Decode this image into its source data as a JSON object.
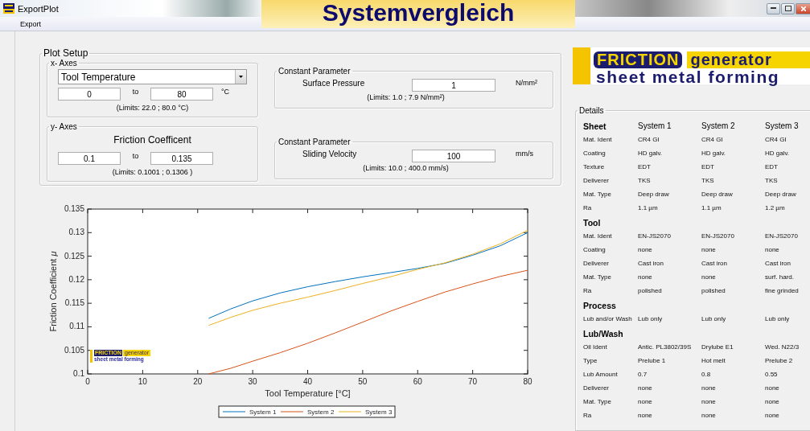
{
  "overlay_title": "Systemvergleich",
  "window": {
    "title": "ExportPlot"
  },
  "menu": [
    "Export"
  ],
  "plot_setup": {
    "title": "Plot Setup",
    "x_axes": {
      "title": "x- Axes",
      "dropdown": "Tool Temperature",
      "from": "0",
      "to_label": "to",
      "to": "80",
      "unit": "°C",
      "limits": "(Limits: 22.0 ; 80.0 °C)"
    },
    "y_axes": {
      "title": "y- Axes",
      "quantity": "Friction Coefficent",
      "from": "0.1",
      "to_label": "to",
      "to": "0.135",
      "limits": "(Limits: 0.1001 ; 0.1306 )"
    },
    "constant_parameters": [
      {
        "title": "Constant Parameter",
        "label": "Surface Pressure",
        "value": "1",
        "unit": "N/mm²",
        "limits": "(Limits: 1.0 ; 7.9 N/mm²)"
      },
      {
        "title": "Constant Parameter",
        "label": "Sliding Velocity",
        "value": "100",
        "unit": "mm/s",
        "limits": "(Limits: 10.0 ; 400.0 mm/s)"
      }
    ]
  },
  "plot": {
    "logo": {
      "word_1": "FRICTION",
      "word_2": "generator",
      "line_2": "sheet metal forming"
    },
    "chart_data": {
      "type": "line",
      "legend": "bottom",
      "xlabel": "Tool Temperature [°C]",
      "ylabel": "Friction Coefficient *μ*",
      "x": [
        22,
        26,
        30,
        35,
        40,
        45,
        50,
        55,
        60,
        65,
        70,
        75,
        80
      ],
      "xlim": [
        0,
        80
      ],
      "ylim": [
        0.1,
        0.135
      ],
      "xticks": [
        0,
        10,
        20,
        30,
        40,
        50,
        60,
        70,
        80
      ],
      "yticks": [
        0.1,
        0.105,
        0.11,
        0.115,
        0.12,
        0.125,
        0.13,
        0.135
      ],
      "series": [
        {
          "name": "System 1",
          "color": "#0072bd",
          "values": [
            0.1118,
            0.1138,
            0.1155,
            0.1172,
            0.1185,
            0.1196,
            0.1206,
            0.1215,
            0.1224,
            0.1235,
            0.1252,
            0.1272,
            0.13
          ]
        },
        {
          "name": "System 2",
          "color": "#d95319",
          "values": [
            0.1,
            0.1012,
            0.1027,
            0.1045,
            0.1065,
            0.1087,
            0.111,
            0.1133,
            0.1154,
            0.1174,
            0.1191,
            0.1207,
            0.122
          ]
        },
        {
          "name": "System 3",
          "color": "#edb120",
          "values": [
            0.1103,
            0.112,
            0.1135,
            0.115,
            0.1163,
            0.1177,
            0.1192,
            0.1206,
            0.1222,
            0.1236,
            0.1254,
            0.1276,
            0.1305
          ]
        }
      ]
    }
  },
  "logo": {
    "word_1": "FRICTION",
    "word_2": "generator",
    "line_2": "sheet metal forming"
  },
  "details": {
    "title": "Details",
    "columns": [
      "System 1",
      "System 2",
      "System 3"
    ],
    "sections": [
      {
        "title": "Sheet",
        "rows": [
          {
            "label": "Mat. Ident",
            "values": [
              "CR4 GI",
              "CR4 GI",
              "CR4 GI"
            ]
          },
          {
            "label": "Coating",
            "values": [
              "HD galv.",
              "HD galv.",
              "HD galv."
            ]
          },
          {
            "label": "Texture",
            "values": [
              "EDT",
              "EDT",
              "EDT"
            ]
          },
          {
            "label": "Deliverer",
            "values": [
              "TKS",
              "TKS",
              "TKS"
            ]
          },
          {
            "label": "Mat. Type",
            "values": [
              "Deep draw",
              "Deep draw",
              "Deep draw"
            ]
          },
          {
            "label": "Ra",
            "values": [
              "1.1 µm",
              "1.1 µm",
              "1.2 µm"
            ]
          }
        ]
      },
      {
        "title": "Tool",
        "rows": [
          {
            "label": "Mat. Ident",
            "values": [
              "EN-JS2070",
              "EN-JS2070",
              "EN-JS2070"
            ]
          },
          {
            "label": "Coating",
            "values": [
              "none",
              "none",
              "none"
            ]
          },
          {
            "label": "Deliverer",
            "values": [
              "Cast iron",
              "Cast iron",
              "Cast iron"
            ]
          },
          {
            "label": "Mat. Type",
            "values": [
              "none",
              "none",
              "surf. hard."
            ]
          },
          {
            "label": "Ra",
            "values": [
              "polished",
              "polished",
              "fine grinded"
            ]
          }
        ]
      },
      {
        "title": "Process",
        "rows": [
          {
            "label": "Lub and/or Wash",
            "values": [
              "Lub only",
              "Lub only",
              "Lub only"
            ]
          }
        ]
      },
      {
        "title": "Lub/Wash",
        "rows": [
          {
            "label": "Oil Ident",
            "values": [
              "Antic. PL3802/39S",
              "Drylube E1",
              "Wed. N22/3"
            ]
          },
          {
            "label": "Type",
            "values": [
              "Prelube 1",
              "Hot melt",
              "Prelube 2"
            ]
          },
          {
            "label": "Lub Amount",
            "values": [
              "0.7",
              "0.8",
              "0.55"
            ]
          },
          {
            "label": "Deliverer",
            "values": [
              "none",
              "none",
              "none"
            ]
          },
          {
            "label": "Mat. Type",
            "values": [
              "none",
              "none",
              "none"
            ]
          },
          {
            "label": "Ra",
            "values": [
              "none",
              "none",
              "none"
            ]
          }
        ]
      }
    ]
  }
}
